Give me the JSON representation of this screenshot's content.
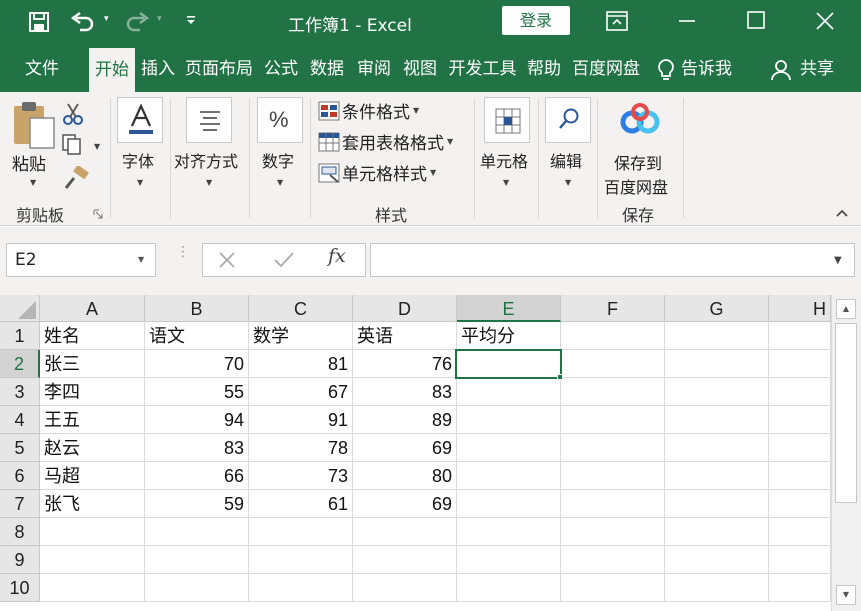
{
  "titlebar": {
    "title": "工作簿1  -  Excel",
    "login": "登录",
    "undo_dd": "▾",
    "redo_dd": "▾"
  },
  "tabs": [
    {
      "label": "文件",
      "active": false
    },
    {
      "label": "开始",
      "active": true
    },
    {
      "label": "插入",
      "active": false
    },
    {
      "label": "页面布局",
      "active": false
    },
    {
      "label": "公式",
      "active": false
    },
    {
      "label": "数据",
      "active": false
    },
    {
      "label": "审阅",
      "active": false
    },
    {
      "label": "视图",
      "active": false
    },
    {
      "label": "开发工具",
      "active": false
    },
    {
      "label": "帮助",
      "active": false
    },
    {
      "label": "百度网盘",
      "active": false
    }
  ],
  "tell_me": "告诉我",
  "share": "共享",
  "ribbon": {
    "paste": "粘贴",
    "clipboard_group": "剪贴板",
    "font": "字体",
    "alignment": "对齐方式",
    "number": "数字",
    "cond_format": "条件格式",
    "table_format": "套用表格格式",
    "cell_style": "单元格样式",
    "styles_group": "样式",
    "cells": "单元格",
    "editing": "编辑",
    "save_baidu_line1": "保存到",
    "save_baidu_line2": "百度网盘",
    "save_group": "保存"
  },
  "formula_bar": {
    "name_box": "E2",
    "fx": "fx",
    "content": ""
  },
  "grid": {
    "columns": [
      "A",
      "B",
      "C",
      "D",
      "E",
      "F",
      "G",
      "H"
    ],
    "selected_column": "E",
    "selected_row": 2,
    "rows": [
      1,
      2,
      3,
      4,
      5,
      6,
      7,
      8,
      9,
      10
    ],
    "headers": [
      "姓名",
      "语文",
      "数学",
      "英语",
      "平均分"
    ],
    "data": [
      {
        "name": "张三",
        "chinese": 70,
        "math": 81,
        "english": 76
      },
      {
        "name": "李四",
        "chinese": 55,
        "math": 67,
        "english": 83
      },
      {
        "name": "王五",
        "chinese": 94,
        "math": 91,
        "english": 89
      },
      {
        "name": "赵云",
        "chinese": 83,
        "math": 78,
        "english": 69
      },
      {
        "name": "马超",
        "chinese": 66,
        "math": 73,
        "english": 80
      },
      {
        "name": "张飞",
        "chinese": 59,
        "math": 61,
        "english": 69
      }
    ]
  },
  "colors": {
    "brand": "#217346",
    "ribbon_bg": "#f3f2f1",
    "header_bg": "#e6e6e6"
  }
}
